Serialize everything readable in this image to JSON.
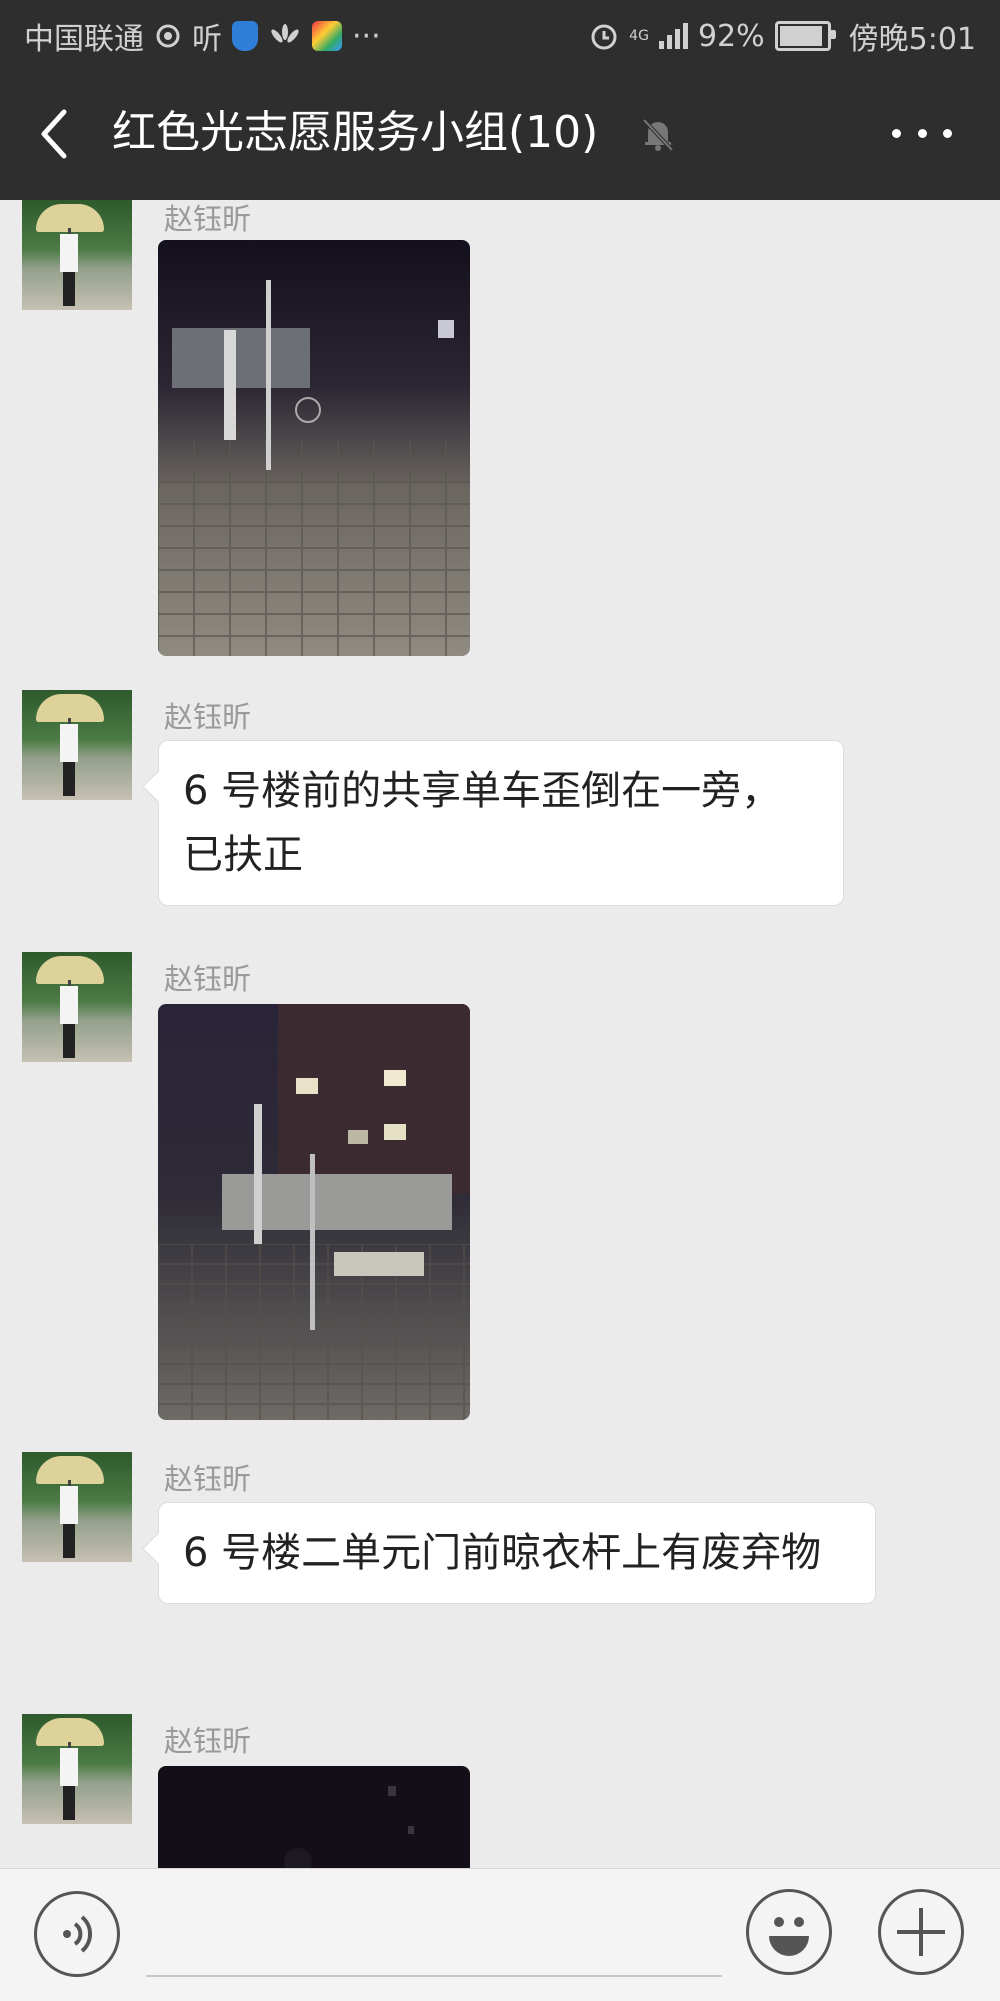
{
  "status_bar": {
    "carrier": "中国联通",
    "listen": "听",
    "extra": "···",
    "network_badge": "4G",
    "battery": "92%",
    "time": "傍晚5:01"
  },
  "header": {
    "title": "红色光志愿服务小组(10)"
  },
  "messages": [
    {
      "sender": "赵钰昕",
      "type": "image"
    },
    {
      "sender": "赵钰昕",
      "type": "text",
      "text": "6 号楼前的共享单车歪倒在一旁，已扶正"
    },
    {
      "sender": "赵钰昕",
      "type": "image"
    },
    {
      "sender": "赵钰昕",
      "type": "text",
      "text": "6 号楼二单元门前晾衣杆上有废弃物"
    },
    {
      "sender": "赵钰昕",
      "type": "image"
    }
  ],
  "icons": {
    "back": "back-arrow-icon",
    "mute": "bell-muted-icon",
    "more": "more-dots-icon",
    "voice": "voice-icon",
    "emoji": "emoji-icon",
    "add": "plus-icon"
  },
  "colors": {
    "header_bg": "#2e2e2e",
    "chat_bg": "#ebebeb",
    "bubble_bg": "#ffffff"
  }
}
